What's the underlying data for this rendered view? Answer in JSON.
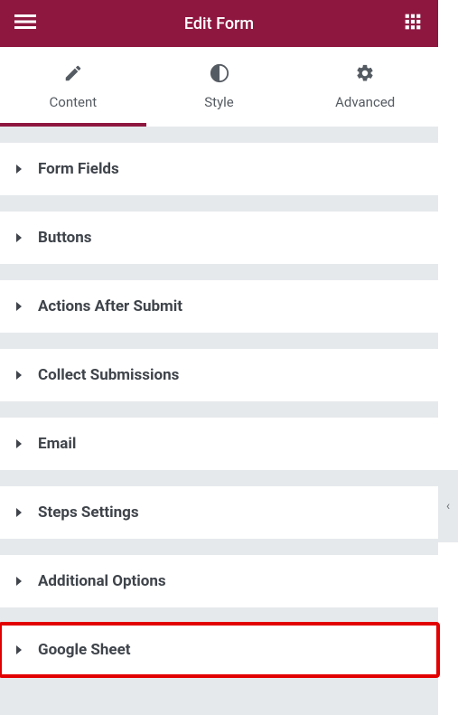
{
  "header": {
    "title": "Edit Form"
  },
  "tabs": [
    {
      "id": "content",
      "label": "Content",
      "active": true
    },
    {
      "id": "style",
      "label": "Style",
      "active": false
    },
    {
      "id": "advanced",
      "label": "Advanced",
      "active": false
    }
  ],
  "sections": [
    {
      "id": "form-fields",
      "label": "Form Fields",
      "highlight": false
    },
    {
      "id": "buttons",
      "label": "Buttons",
      "highlight": false
    },
    {
      "id": "actions-after-submit",
      "label": "Actions After Submit",
      "highlight": false
    },
    {
      "id": "collect-submissions",
      "label": "Collect Submissions",
      "highlight": false
    },
    {
      "id": "email",
      "label": "Email",
      "highlight": false
    },
    {
      "id": "steps-settings",
      "label": "Steps Settings",
      "highlight": false
    },
    {
      "id": "additional-options",
      "label": "Additional Options",
      "highlight": false
    },
    {
      "id": "google-sheet",
      "label": "Google Sheet",
      "highlight": true
    }
  ],
  "collapse_handle_glyph": "‹"
}
